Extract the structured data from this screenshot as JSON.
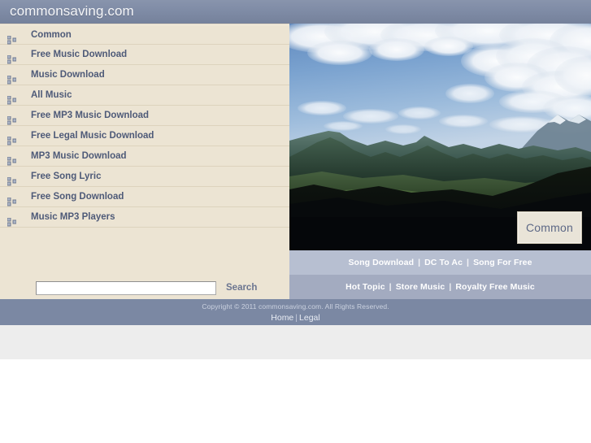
{
  "header": {
    "site_title": "commonsaving.com",
    "background_color": "#7b88a3"
  },
  "sidebar": {
    "background_color": "#ece4d3",
    "bullet_icon": "list-bullet-icon",
    "items": [
      {
        "label": "Common"
      },
      {
        "label": "Free Music Download"
      },
      {
        "label": "Music Download"
      },
      {
        "label": "All Music"
      },
      {
        "label": "Free MP3 Music Download"
      },
      {
        "label": "Free Legal Music Download"
      },
      {
        "label": "MP3 Music Download"
      },
      {
        "label": "Free Song Lyric"
      },
      {
        "label": "Free Song Download"
      },
      {
        "label": "Music MP3 Players"
      }
    ]
  },
  "search": {
    "value": "",
    "placeholder": "",
    "button_label": "Search"
  },
  "hero": {
    "alt": "Mountain landscape with clouds",
    "badge_label": "Common"
  },
  "link_bars": [
    {
      "background_color": "#b7bfd1",
      "links": [
        "Song Download",
        "DC To Ac",
        "Song For Free"
      ],
      "separator": "|"
    },
    {
      "background_color": "#a3abc0",
      "links": [
        "Hot Topic",
        "Store Music",
        "Royalty Free Music"
      ],
      "separator": "|"
    }
  ],
  "footer": {
    "background_color": "#7b88a3",
    "copyright": "Copyright © 2011 commonsaving.com. All Rights Reserved.",
    "links": [
      "Home",
      "Legal"
    ],
    "separator": "|"
  }
}
